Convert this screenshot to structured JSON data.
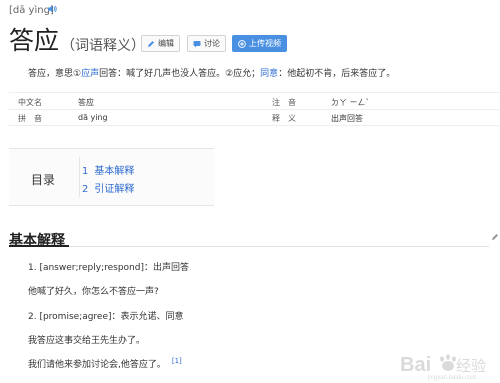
{
  "header": {
    "pinyin": "[dā yìng]",
    "title": "答应",
    "subtitle": "（词语释义）"
  },
  "toolbar": {
    "edit_label": "编辑",
    "discuss_label": "讨论",
    "upload_video_label": "上传视频"
  },
  "summary": {
    "part1": "答应，意思①",
    "link1": "应声",
    "part2": "回答：喊了好几声也没人答应。②应允；",
    "link2": "同意",
    "part3": "：他起初不肯，后来答应了。"
  },
  "info": {
    "rows": [
      {
        "k1": "中文名",
        "v1": "答应",
        "k2": "注　音",
        "v2": "ㄉㄚ ㄧㄥˋ"
      },
      {
        "k1": "拼　音",
        "v1": "dā ying",
        "k2": "释　义",
        "v2": "出声回答"
      }
    ]
  },
  "toc": {
    "title": "目录",
    "items": [
      {
        "num": "1",
        "label": "基本解释"
      },
      {
        "num": "2",
        "label": "引证解释"
      }
    ]
  },
  "section": {
    "title": "基本解释",
    "lines": [
      "1. [answer;reply;respond]：出声回答",
      "他喊了好久，你怎么不答应一声?",
      "2. [promise;agree]：表示允诺、同意",
      "我答应这事交给王先生办了。",
      "我们请他来参加讨论会,他答应了。"
    ],
    "ref": "[1]"
  },
  "watermark": {
    "text": "Bai",
    "sub": "jingyan.baidu.com"
  },
  "colors": {
    "link": "#2e6bd1",
    "primary_button": "#4a90e2"
  }
}
